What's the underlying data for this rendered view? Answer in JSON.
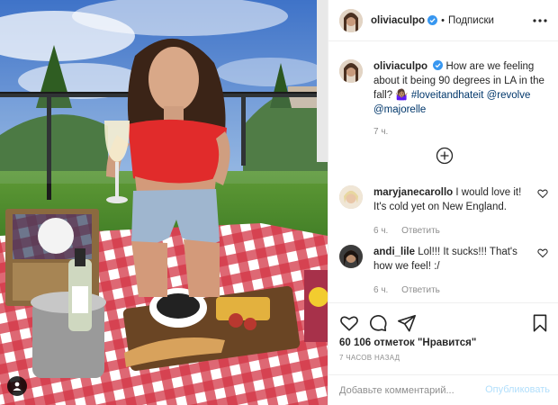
{
  "post": {
    "username": "oliviaculpo",
    "follow_separator": "•",
    "follow_label": "Подписки",
    "more_icon": "more-horizontal-icon",
    "verified_icon": "verified-badge-icon",
    "caption": {
      "username": "oliviaculpo",
      "text": "How are we feeling about it being 90 degrees in LA in the fall? ",
      "emoji": "🤷🏽‍♀️",
      "hashtag": "#loveitandhateit",
      "mention1": "@revolve",
      "mention2": "@majorelle",
      "time": "7 ч."
    },
    "load_more_icon": "plus-circle-icon",
    "comments": [
      {
        "username": "maryjanecarollo",
        "text": "I would love it! It's cold yet on New England.",
        "time": "6 ч.",
        "reply": "Ответить",
        "like_icon": "heart-outline-icon"
      },
      {
        "username": "andi_lile",
        "text": "Lol!!! It sucks!!! That's how we feel! :/",
        "time": "6 ч.",
        "reply": "Ответить",
        "like_icon": "heart-outline-icon"
      }
    ],
    "actions": {
      "like_icon": "heart-icon",
      "comment_icon": "comment-bubble-icon",
      "share_icon": "paper-plane-icon",
      "save_icon": "bookmark-icon"
    },
    "likes_text": "60 106 отметок \"Нравится\"",
    "time_ago": "7 часов назад",
    "add_comment_placeholder": "Добавьте комментарий...",
    "publish_label": "Опубликовать",
    "colors": {
      "link": "#00376b",
      "verified": "#3897f0",
      "publish_disabled": "#b2dffc",
      "muted": "#8e8e8e"
    }
  }
}
